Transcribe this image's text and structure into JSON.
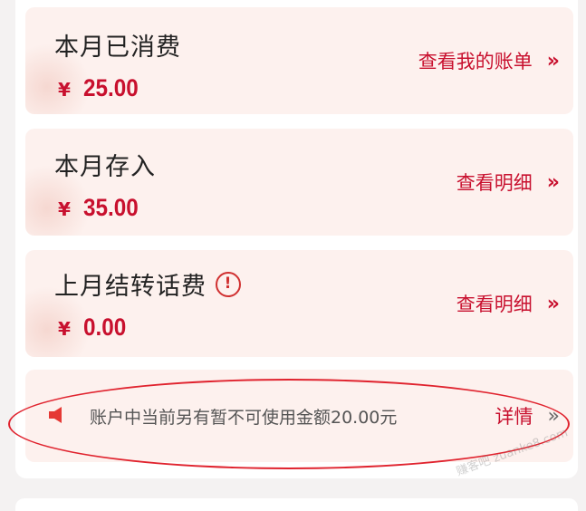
{
  "cards": [
    {
      "title": "本月已消费",
      "currency": "¥",
      "amount": "25.00",
      "link": "查看我的账单"
    },
    {
      "title": "本月存入",
      "currency": "¥",
      "amount": "35.00",
      "link": "查看明细"
    },
    {
      "title": "上月结转话费",
      "info_icon": "!",
      "currency": "¥",
      "amount": "0.00",
      "link": "查看明细"
    }
  ],
  "notice": {
    "icon": "speaker-icon",
    "text": "账户中当前另有暂不可使用金额20.00元",
    "link": "详情"
  },
  "chevron": "»",
  "watermark": "赚客吧 zuanke8.com",
  "colors": {
    "accent": "#c8102e",
    "card_bg": "#fdf1ee",
    "annotation": "#e0232e"
  }
}
